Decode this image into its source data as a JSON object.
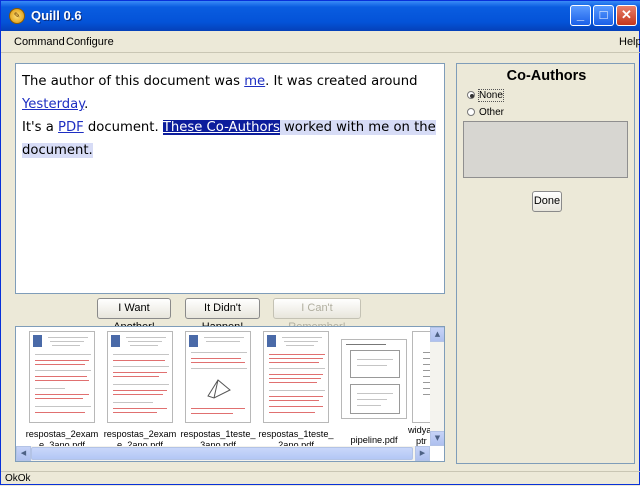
{
  "window": {
    "title": "Quill 0.6",
    "icon": "quill-app-icon"
  },
  "menu": {
    "command": "Command",
    "configure": "Configure",
    "help": "Help"
  },
  "document": {
    "parts": [
      {
        "text": "The author of this document was ",
        "style": "plain"
      },
      {
        "text": "me",
        "style": "link"
      },
      {
        "text": ". It was created around ",
        "style": "plain"
      },
      {
        "text": "Yesterday",
        "style": "link"
      },
      {
        "text": ".",
        "style": "plain"
      },
      {
        "text": "It's a ",
        "style": "plain"
      },
      {
        "text": "PDF",
        "style": "link"
      },
      {
        "text": " document. ",
        "style": "plain"
      },
      {
        "text": "These Co-Authors",
        "style": "selected"
      },
      {
        "text": " worked with me on the",
        "style": "highlight"
      },
      {
        "text": "document.",
        "style": "highlight"
      }
    ]
  },
  "actions": {
    "another": "I Want Another!",
    "didnt_happen": "It Didn't Happen!",
    "cant_remember": "I Can't Remember!"
  },
  "thumbnails": [
    {
      "label": "respostas_2exame_3ano.pdf",
      "line1": "respostas_2exam",
      "line2": "e_3ano.pdf",
      "kind": "exam"
    },
    {
      "label": "respostas_2exame_2ano.pdf",
      "line1": "respostas_2exam",
      "line2": "e_2ano.pdf",
      "kind": "exam"
    },
    {
      "label": "respostas_1teste_3ano.pdf",
      "line1": "respostas_1teste_",
      "line2": "3ano.pdf",
      "kind": "exam2"
    },
    {
      "label": "respostas_1teste_2ano.pdf",
      "line1": "respostas_1teste_",
      "line2": "2ano.pdf",
      "kind": "exam"
    },
    {
      "label": "pipeline.pdf",
      "line1": "pipeline.pdf",
      "line2": "",
      "kind": "slides"
    },
    {
      "label": "widyan...ptr",
      "line1": "widyan",
      "line2": "ptr",
      "kind": "dense"
    }
  ],
  "coauthors": {
    "title": "Co-Authors",
    "options": [
      {
        "label": "None",
        "selected": true
      },
      {
        "label": "Other",
        "selected": false
      }
    ],
    "done": "Done"
  },
  "status": {
    "text": "OkOk"
  }
}
